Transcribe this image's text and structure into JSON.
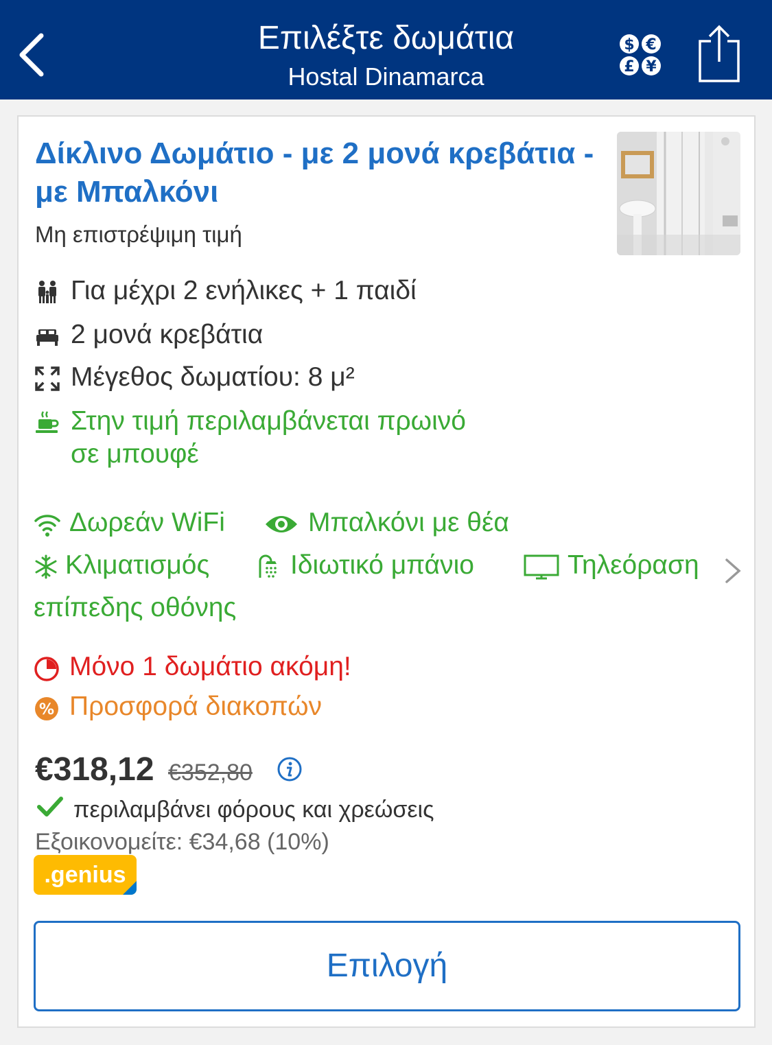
{
  "header": {
    "title": "Επιλέξτε δωμάτια",
    "subtitle": "Hostal Dinamarca",
    "currency_symbols": [
      "$",
      "€",
      "£",
      "¥"
    ],
    "bg_color": "#003580"
  },
  "room": {
    "title": "Δίκλινο Δωμάτιο - με 2 μονά κρεβάτια - με Μπαλκόνι",
    "policy": "Μη επιστρέψιμη τιμή",
    "features": {
      "occupancy": "Για μέχρι 2 ενήλικες + 1 παιδί",
      "beds": "2 μονά κρεβάτια",
      "size": "Μέγεθος δωματίου: 8 μ²",
      "breakfast_line1": "Στην τιμή περιλαμβάνεται πρωινό",
      "breakfast_line2": "σε μπουφέ"
    },
    "amenities": {
      "wifi": "Δωρεάν WiFi",
      "balcony": "Μπαλκόνι με θέα",
      "ac": "Κλιματισμός",
      "bathroom": "Ιδιωτικό μπάνιο",
      "tv_line1": "Τηλεόραση",
      "tv_line2": "επίπεδης οθόνης"
    },
    "availability": "Μόνο 1 δωμάτιο ακόμη!",
    "deal": "Προσφορά διακοπών",
    "price": {
      "current": "€318,12",
      "original": "€352,80",
      "taxes_note": "περιλαμβάνει φόρους και χρεώσεις",
      "savings": "Εξοικονομείτε: €34,68 (10%)"
    },
    "genius_badge": ".genius",
    "select_label": "Επιλογή"
  },
  "colors": {
    "accent_blue": "#1f6fc5",
    "green": "#3aaa35",
    "red": "#e02020",
    "orange": "#e8872a",
    "genius_yellow": "#febb02"
  }
}
